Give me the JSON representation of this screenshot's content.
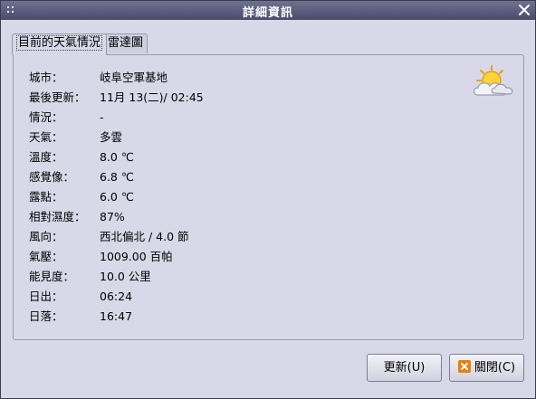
{
  "window": {
    "title": "詳細資訊",
    "close_glyph": "✕"
  },
  "tabs": [
    {
      "label": "目前的天氣情況",
      "active": true
    },
    {
      "label": "雷達圖",
      "active": false
    }
  ],
  "details": [
    {
      "label": "城市：",
      "value": "岐阜空軍基地"
    },
    {
      "label": "最後更新：",
      "value": "11月 13(二)/ 02:45"
    },
    {
      "label": "情況：",
      "value": "-"
    },
    {
      "label": "天氣：",
      "value": "多雲"
    },
    {
      "label": "溫度：",
      "value": "8.0 ℃"
    },
    {
      "label": "感覺像：",
      "value": "6.8 ℃"
    },
    {
      "label": "露點：",
      "value": "6.0 ℃"
    },
    {
      "label": "相對濕度：",
      "value": "87%"
    },
    {
      "label": "風向：",
      "value": "西北偏北 / 4.0 節"
    },
    {
      "label": "氣壓：",
      "value": "1009.00 百帕"
    },
    {
      "label": "能見度：",
      "value": "10.0 公里"
    },
    {
      "label": "日出：",
      "value": "06:24"
    },
    {
      "label": "日落：",
      "value": "16:47"
    }
  ],
  "weather_icon": "partly-cloudy-icon",
  "buttons": {
    "refresh_label": "更新(U)",
    "close_label": "關閉(C)"
  },
  "colors": {
    "titlebar": "#5a5c7a",
    "background": "#d8d8e8",
    "close_icon_accent": "#e8800e"
  }
}
